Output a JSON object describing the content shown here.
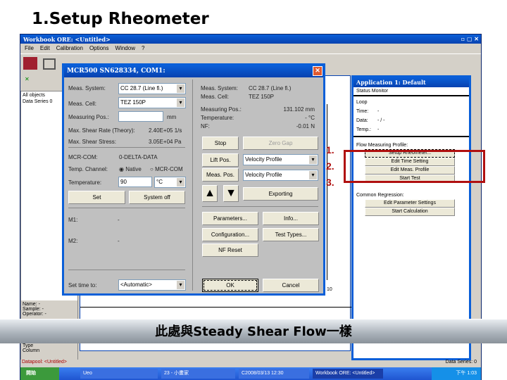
{
  "slide_title": "1.Setup Rheometer",
  "app": {
    "title": "Workbook ORE: <Untitled>",
    "menu": [
      "File",
      "Edit",
      "Calibration",
      "Options",
      "Window",
      "?"
    ]
  },
  "left_panel": {
    "top_lines": [
      "All objects",
      "Data Series 0"
    ],
    "info": [
      {
        "k": "Name:",
        "v": "-"
      },
      {
        "k": "Sample:",
        "v": "-"
      },
      {
        "k": "Operator:",
        "v": "-"
      }
    ],
    "bottom_lines": [
      "Type",
      "Column"
    ]
  },
  "dialog": {
    "title": "MCR500 SN628334, COM1:",
    "meas_system_label": "Meas. System:",
    "meas_system_value": "CC 28.7 (Line fi.)",
    "meas_cell_label": "Meas. Cell:",
    "meas_cell_value": "TEZ 150P",
    "measuring_pos_label": "Measuring Pos.:",
    "measuring_pos_unit": "mm",
    "max_shear_rate_label": "Max. Shear Rate (Theory):",
    "max_shear_rate_value": "2.40E+05 1/s",
    "max_shear_stress_label": "Max. Shear Stress:",
    "max_shear_stress_value": "3.05E+04 Pa",
    "mcr_com_label": "MCR-COM:",
    "mcr_com_value": "0-DELTA-DATA",
    "temp_channel_label": "Temp. Channel:",
    "radio_native": "Native",
    "radio_mcr": "MCR-COM",
    "temperature_label": "Temperature:",
    "temperature_value": "90",
    "temperature_unit": "°C",
    "set": "Set",
    "system_off": "System off",
    "m1_label": "M1:",
    "m1_value": "-",
    "m2_label": "M2:",
    "m2_value": "-",
    "set_time_label": "Set time to:",
    "set_time_value": "<Automatic>",
    "status": [
      {
        "k": "Meas. System:",
        "v": "CC 28.7 (Line fi.)"
      },
      {
        "k": "Meas. Cell:",
        "v": "TEZ 150P"
      },
      {
        "k": "Measuring Pos.:",
        "v": "131.102 mm"
      },
      {
        "k": "Temperature:",
        "v": "- °C"
      },
      {
        "k": "NF:",
        "v": "-0.01 N"
      }
    ],
    "stop": "Stop",
    "zero_gap": "Zero Gap",
    "lift_pos": "Lift Pos.",
    "lift_profile": "Velocity Profile",
    "meas_pos": "Meas. Pos.",
    "meas_profile": "Velocity Profile",
    "exporting": "Exporting",
    "parameters": "Parameters...",
    "info": "Info...",
    "configuration": "Configuration...",
    "test_types": "Test Types...",
    "nf_reset": "NF Reset",
    "ok": "OK",
    "cancel": "Cancel"
  },
  "app_window": {
    "title": "Application 1: Default",
    "status_monitor": "Status Monitor",
    "status": [
      {
        "k": "Loop",
        "v": ""
      },
      {
        "k": "Time:",
        "v": "-"
      },
      {
        "k": "Data:",
        "v": "- / -"
      },
      {
        "k": "Temp.:",
        "v": "-"
      }
    ],
    "profile_label": "Flow Measuring Profile:",
    "buttons": [
      "Setup Rheometer...",
      "Edit Time Setting",
      "Edit Meas. Profile",
      "Start Test"
    ],
    "regression_label": "Common Regression:",
    "reg_buttons": [
      "Edit Parameter Settings",
      "Start Calculation"
    ]
  },
  "graph": {
    "axis_label": "10"
  },
  "steps": [
    "1.",
    "2.",
    "3."
  ],
  "banner": "此處與Steady Shear Flow一樣",
  "statusbar": {
    "left": "Datapool: <Untitled>",
    "right": "Data Series: 0"
  },
  "taskbar": {
    "start": "開始",
    "items": [
      "Ueo",
      "23 - 小畫家",
      "C2008/03/13 12:30",
      "Workbook ORE: <Untitled>"
    ],
    "clock": "下午 1:03"
  },
  "colors": {
    "accent": "#b01010",
    "titlebar": "#0a5fd8"
  }
}
